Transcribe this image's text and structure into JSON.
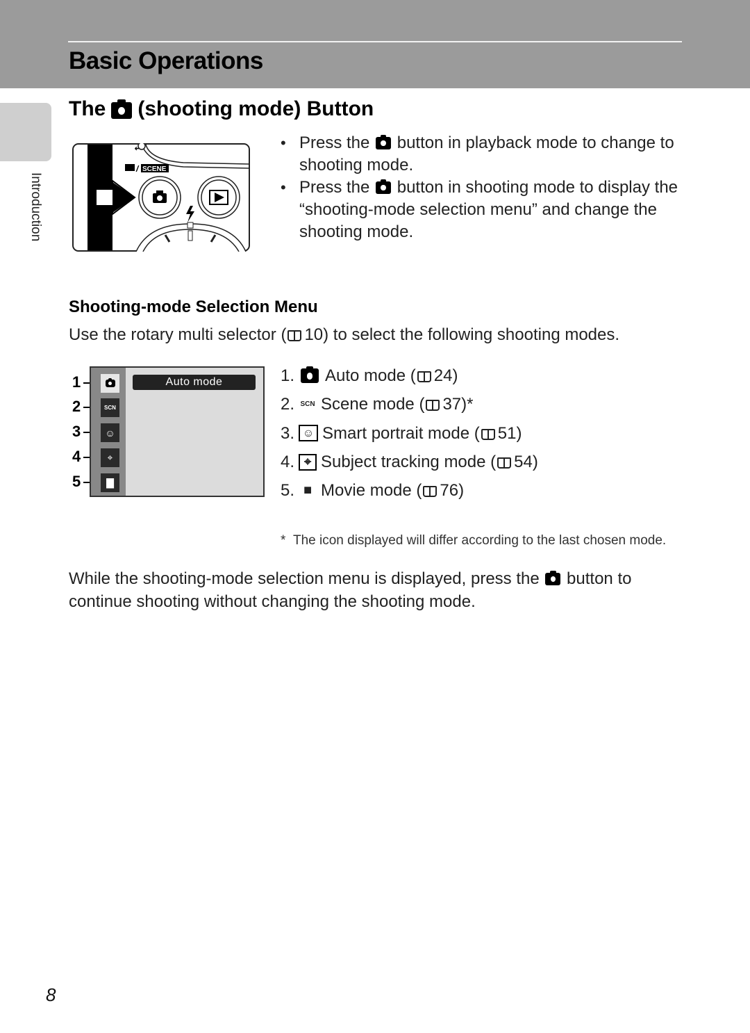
{
  "header": {
    "title": "Basic Operations"
  },
  "sidebar": {
    "label": "Introduction"
  },
  "section": {
    "title_prefix": "The",
    "title_icon": "camera-icon",
    "title_suffix": "(shooting mode) Button"
  },
  "illustration": {
    "label_movie_scene": "/ SCENE",
    "icons": [
      "movie-icon",
      "scene-icon",
      "shooting-mode-button",
      "playback-button",
      "flash-icon",
      "rotary-multi-selector",
      "arrow-pointer"
    ]
  },
  "bullets": [
    {
      "pre": "Press the",
      "icon": "camera-icon",
      "post": "button in playback mode to change to shooting mode."
    },
    {
      "pre": "Press the",
      "icon": "camera-icon",
      "post": "button in shooting mode to display the “shooting-mode selection menu” and change the shooting mode."
    }
  ],
  "menu_section": {
    "title": "Shooting-mode Selection Menu",
    "intro_pre": "Use the rotary multi selector (",
    "intro_ref": "10",
    "intro_post": ") to select the following shooting modes."
  },
  "menu_screen": {
    "selected_label": "Auto mode",
    "callout_numbers": [
      "1",
      "2",
      "3",
      "4",
      "5"
    ],
    "icons": [
      "camera-icon",
      "scene-icon",
      "smart-portrait-icon",
      "subject-tracking-icon",
      "movie-icon"
    ]
  },
  "modes": [
    {
      "num": "1.",
      "icon": "camera-icon",
      "glyph": "",
      "label": "Auto mode (",
      "ref": "24)",
      "note": ""
    },
    {
      "num": "2.",
      "icon": "scene-icon",
      "glyph": "SCN",
      "label": "Scene mode (",
      "ref": "37)",
      "note": "*"
    },
    {
      "num": "3.",
      "icon": "smart-portrait-icon",
      "glyph": "☺",
      "label": "Smart portrait mode (",
      "ref": "51)",
      "note": ""
    },
    {
      "num": "4.",
      "icon": "subject-tracking-icon",
      "glyph": "⌖",
      "label": "Subject tracking mode (",
      "ref": "54)",
      "note": ""
    },
    {
      "num": "5.",
      "icon": "movie-icon",
      "glyph": "■",
      "label": "Movie mode (",
      "ref": "76)",
      "note": ""
    }
  ],
  "footnote": {
    "mark": "*",
    "text": "The icon displayed will differ according to the last chosen mode."
  },
  "paragraph": {
    "pre": "While the shooting-mode selection menu is displayed, press the",
    "icon": "camera-icon",
    "post": "button to continue shooting without changing the shooting mode."
  },
  "page": {
    "number": "8"
  }
}
